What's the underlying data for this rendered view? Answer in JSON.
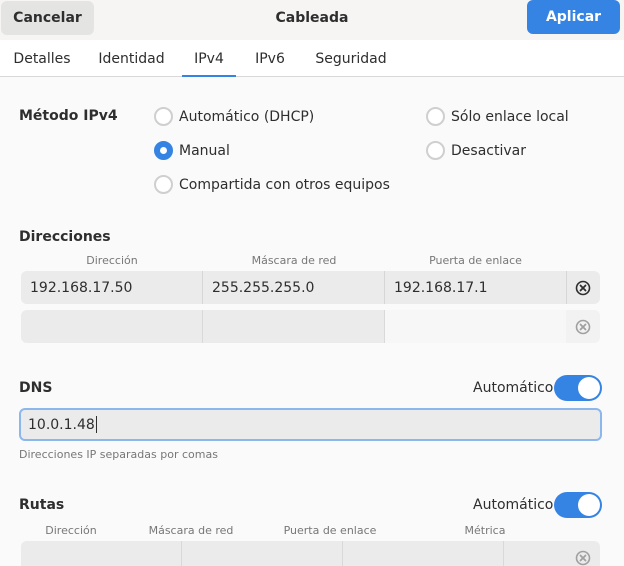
{
  "header": {
    "cancel_label": "Cancelar",
    "title": "Cableada",
    "apply_label": "Aplicar"
  },
  "tabs": [
    {
      "label": "Detalles",
      "active": false
    },
    {
      "label": "Identidad",
      "active": false
    },
    {
      "label": "IPv4",
      "active": true
    },
    {
      "label": "IPv6",
      "active": false
    },
    {
      "label": "Seguridad",
      "active": false
    }
  ],
  "method": {
    "label": "Método IPv4",
    "options": [
      {
        "label": "Automático (DHCP)",
        "checked": false
      },
      {
        "label": "Manual",
        "checked": true
      },
      {
        "label": "Compartida con otros equipos",
        "checked": false
      },
      {
        "label": "Sólo enlace local",
        "checked": false
      },
      {
        "label": "Desactivar",
        "checked": false
      }
    ]
  },
  "addresses": {
    "label": "Direcciones",
    "columns": [
      "Dirección",
      "Máscara de red",
      "Puerta de enlace"
    ],
    "rows": [
      [
        "192.168.17.50",
        "255.255.255.0",
        "192.168.17.1"
      ],
      [
        "",
        "",
        ""
      ]
    ]
  },
  "dns": {
    "label": "DNS",
    "auto_label": "Automático",
    "auto_enabled": true,
    "value": "10.0.1.48",
    "hint": "Direcciones IP separadas por comas"
  },
  "routes": {
    "label": "Rutas",
    "auto_label": "Automático",
    "auto_enabled": true,
    "columns": [
      "Dirección",
      "Máscara de red",
      "Puerta de enlace",
      "Métrica"
    ]
  },
  "colors": {
    "accent": "#3584e4",
    "header_bg": "#f6f5f4"
  }
}
